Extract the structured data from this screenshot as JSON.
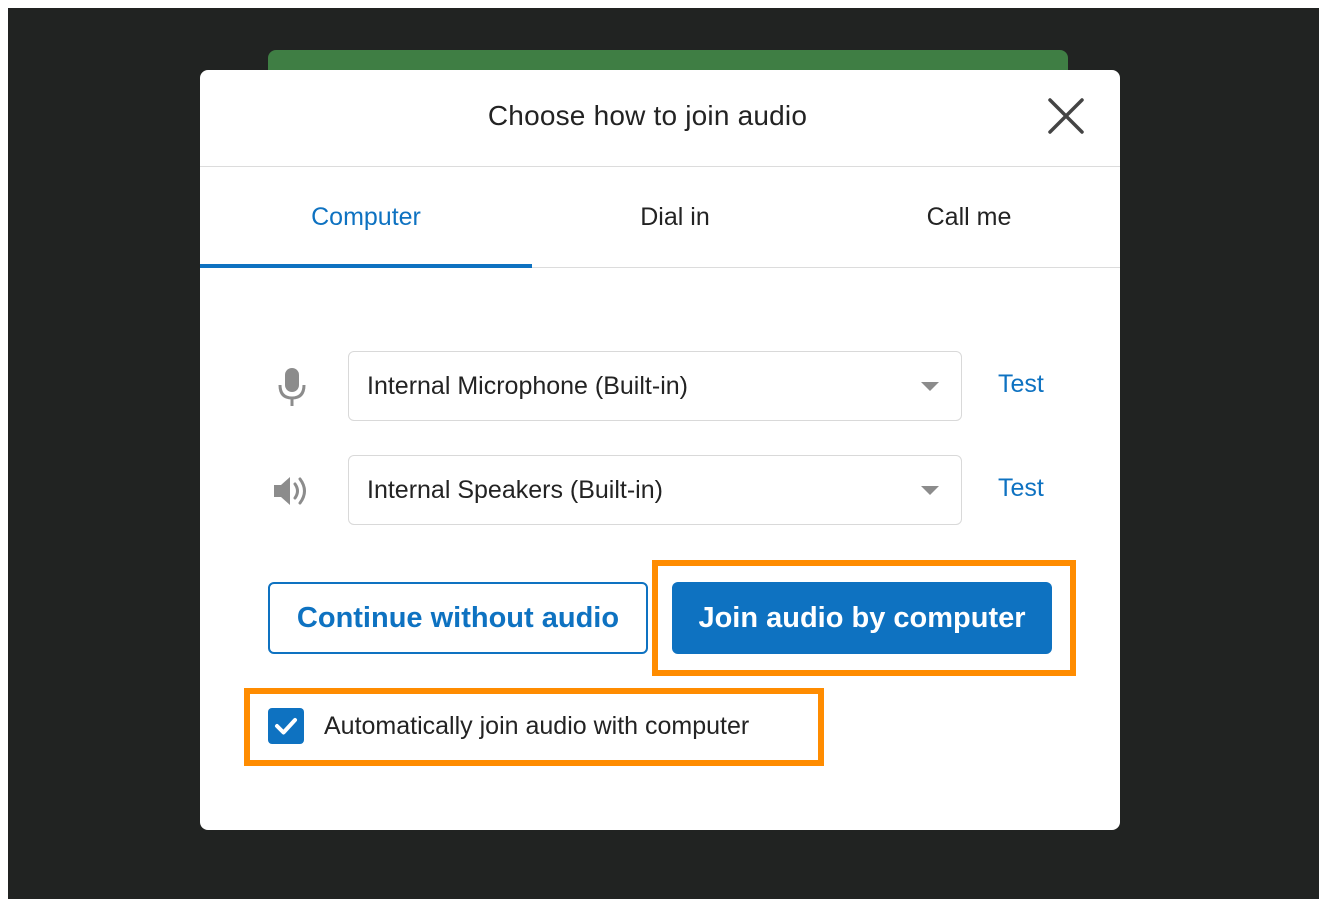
{
  "dialog": {
    "title": "Choose how to join audio",
    "close_icon": "close-icon"
  },
  "tabs": [
    {
      "label": "Computer",
      "active": true
    },
    {
      "label": "Dial in",
      "active": false
    },
    {
      "label": "Call me",
      "active": false
    }
  ],
  "devices": {
    "microphone": {
      "icon": "microphone-icon",
      "selected": "Internal Microphone (Built-in)",
      "test_label": "Test"
    },
    "speaker": {
      "icon": "speaker-icon",
      "selected": "Internal Speakers (Built-in)",
      "test_label": "Test"
    }
  },
  "actions": {
    "continue_label": "Continue without audio",
    "join_label": "Join audio by computer"
  },
  "auto_join": {
    "label": "Automatically join audio with computer",
    "checked": true
  },
  "colors": {
    "accent": "#0e72c1",
    "highlight": "#ff8c00",
    "background": "#212322",
    "meeting_bar": "#3f7e44"
  }
}
